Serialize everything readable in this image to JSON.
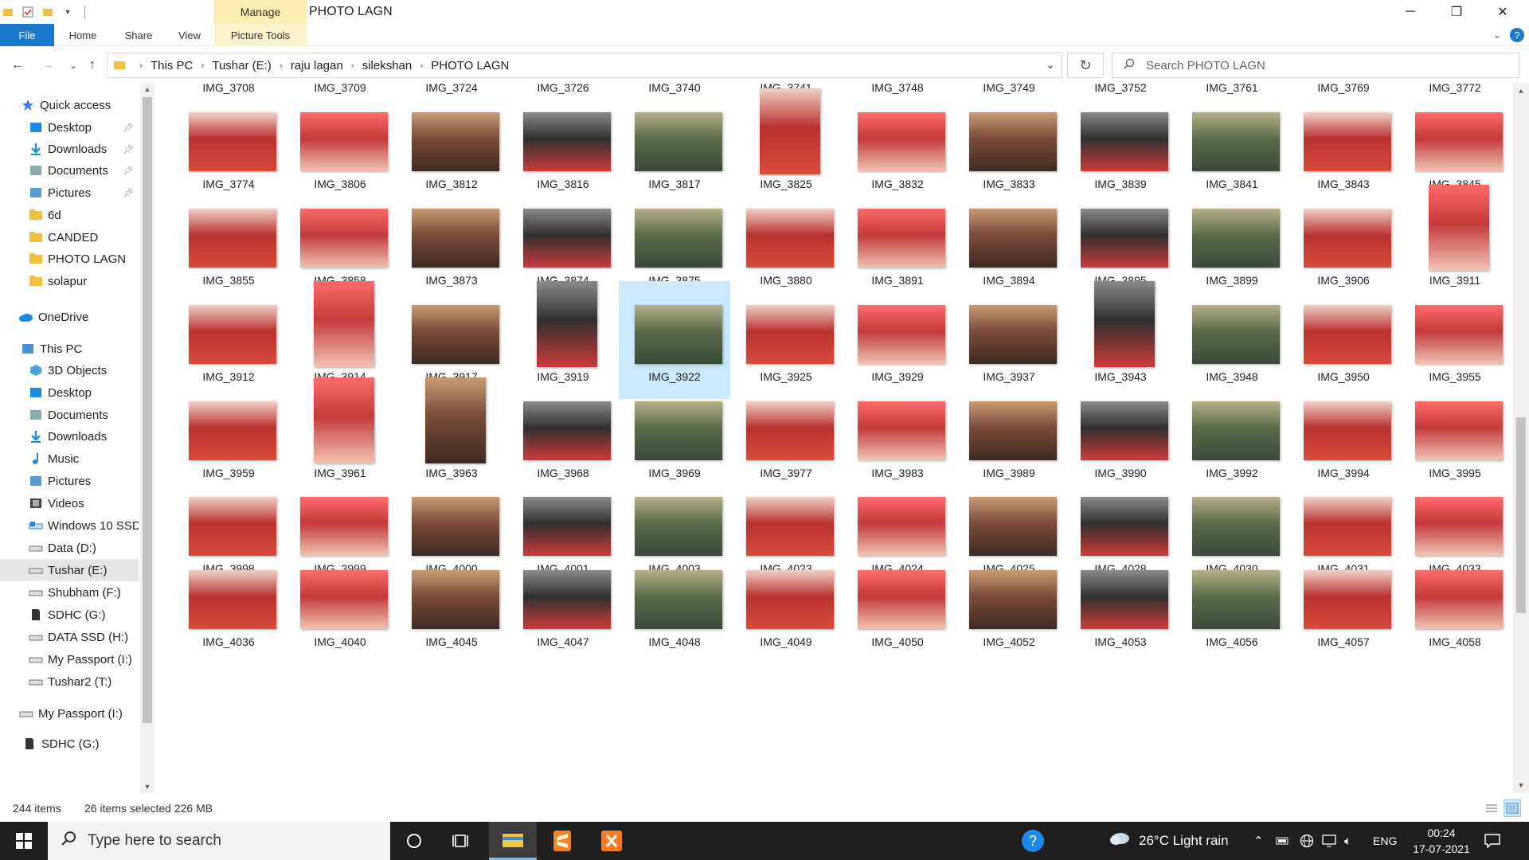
{
  "window": {
    "title": "PHOTO  LAGN",
    "context_tab": "Manage"
  },
  "ribbon": {
    "tabs": [
      "File",
      "Home",
      "Share",
      "View",
      "Picture Tools"
    ]
  },
  "address": {
    "crumbs": [
      "This PC",
      "Tushar (E:)",
      "raju lagan",
      "silekshan",
      "PHOTO  LAGN"
    ],
    "search_placeholder": "Search PHOTO  LAGN"
  },
  "nav": {
    "items": [
      {
        "label": "Quick access",
        "icon": "star-icon",
        "color": "#2b7de9",
        "pinned": false
      },
      {
        "label": "Desktop",
        "icon": "desktop-folder-icon",
        "color": "#1e88e5",
        "pinned": true
      },
      {
        "label": "Downloads",
        "icon": "download-arrow-icon",
        "color": "#1e88e5",
        "pinned": true
      },
      {
        "label": "Documents",
        "icon": "documents-icon",
        "color": "#8aa",
        "pinned": true
      },
      {
        "label": "Pictures",
        "icon": "pictures-icon",
        "color": "#5b9bd5",
        "pinned": true
      },
      {
        "label": "6d",
        "icon": "folder-icon",
        "color": "#f0c040",
        "pinned": false
      },
      {
        "label": "CANDED",
        "icon": "folder-icon",
        "color": "#f0c040",
        "pinned": false
      },
      {
        "label": "PHOTO  LAGN",
        "icon": "folder-icon",
        "color": "#f0c040",
        "pinned": false
      },
      {
        "label": "solapur",
        "icon": "folder-icon",
        "color": "#f0c040",
        "pinned": false
      },
      {
        "label": "OneDrive",
        "icon": "cloud-icon",
        "color": "#1e88e5",
        "pinned": false
      },
      {
        "label": "This PC",
        "icon": "computer-icon",
        "color": "#4a90d9",
        "pinned": false
      },
      {
        "label": "3D Objects",
        "icon": "cube-icon",
        "color": "#4aa3df",
        "pinned": false
      },
      {
        "label": "Desktop",
        "icon": "desktop-folder-icon",
        "color": "#1e88e5",
        "pinned": false
      },
      {
        "label": "Documents",
        "icon": "documents-icon",
        "color": "#8aa",
        "pinned": false
      },
      {
        "label": "Downloads",
        "icon": "download-arrow-icon",
        "color": "#1e88e5",
        "pinned": false
      },
      {
        "label": "Music",
        "icon": "music-note-icon",
        "color": "#1e88e5",
        "pinned": false
      },
      {
        "label": "Pictures",
        "icon": "pictures-icon",
        "color": "#5b9bd5",
        "pinned": false
      },
      {
        "label": "Videos",
        "icon": "film-icon",
        "color": "#555",
        "pinned": false
      },
      {
        "label": "Windows 10 SSD",
        "icon": "windows-drive-icon",
        "color": "#1e88e5",
        "pinned": false
      },
      {
        "label": "Data (D:)",
        "icon": "drive-icon",
        "color": "#777",
        "pinned": false
      },
      {
        "label": "Tushar (E:)",
        "icon": "drive-icon",
        "color": "#777",
        "pinned": false
      },
      {
        "label": "Shubham (F:)",
        "icon": "drive-icon",
        "color": "#777",
        "pinned": false
      },
      {
        "label": "SDHC (G:)",
        "icon": "sd-card-icon",
        "color": "#555",
        "pinned": false
      },
      {
        "label": "DATA SSD (H:)",
        "icon": "drive-icon",
        "color": "#777",
        "pinned": false
      },
      {
        "label": "My Passport (I:)",
        "icon": "drive-icon",
        "color": "#777",
        "pinned": false
      },
      {
        "label": "Tushar2 (T:)",
        "icon": "drive-icon",
        "color": "#777",
        "pinned": false
      },
      {
        "label": "My Passport (I:)",
        "icon": "drive-icon",
        "color": "#777",
        "pinned": false
      },
      {
        "label": "SDHC (G:)",
        "icon": "sd-card-icon",
        "color": "#555",
        "pinned": false
      }
    ],
    "selected": "Tushar (E:)"
  },
  "files": {
    "rows": [
      [
        "IMG_3708",
        "IMG_3709",
        "IMG_3724",
        "IMG_3726",
        "IMG_3740",
        "IMG_3741",
        "IMG_3748",
        "IMG_3749",
        "IMG_3752",
        "IMG_3761",
        "IMG_3769",
        "IMG_3772"
      ],
      [
        "IMG_3774",
        "IMG_3806",
        "IMG_3812",
        "IMG_3816",
        "IMG_3817",
        "IMG_3825",
        "IMG_3832",
        "IMG_3833",
        "IMG_3839",
        "IMG_3841",
        "IMG_3843",
        "IMG_3845"
      ],
      [
        "IMG_3855",
        "IMG_3858",
        "IMG_3873",
        "IMG_3874",
        "IMG_3875",
        "IMG_3880",
        "IMG_3891",
        "IMG_3894",
        "IMG_3895",
        "IMG_3899",
        "IMG_3906",
        "IMG_3911"
      ],
      [
        "IMG_3912",
        "IMG_3914",
        "IMG_3917",
        "IMG_3919",
        "IMG_3922",
        "IMG_3925",
        "IMG_3929",
        "IMG_3937",
        "IMG_3943",
        "IMG_3948",
        "IMG_3950",
        "IMG_3955"
      ],
      [
        "IMG_3959",
        "IMG_3961",
        "IMG_3963",
        "IMG_3968",
        "IMG_3969",
        "IMG_3977",
        "IMG_3983",
        "IMG_3989",
        "IMG_3990",
        "IMG_3992",
        "IMG_3994",
        "IMG_3995"
      ],
      [
        "IMG_3998",
        "IMG_3999",
        "IMG_4000",
        "IMG_4001",
        "IMG_4003",
        "IMG_4023",
        "IMG_4024",
        "IMG_4025",
        "IMG_4028",
        "IMG_4030",
        "IMG_4031",
        "IMG_4033"
      ],
      [
        "IMG_4036",
        "IMG_4040",
        "IMG_4045",
        "IMG_4047",
        "IMG_4048",
        "IMG_4049",
        "IMG_4050",
        "IMG_4052",
        "IMG_4053",
        "IMG_4056",
        "IMG_4057",
        "IMG_4058"
      ]
    ],
    "selected": "IMG_3922",
    "portrait": [
      "IMG_3825",
      "IMG_3911",
      "IMG_3914",
      "IMG_3919",
      "IMG_3943",
      "IMG_3961",
      "IMG_3963"
    ]
  },
  "status": {
    "items": "244 items",
    "selected": "26 items selected  226 MB"
  },
  "taskbar": {
    "search_placeholder": "Type here to search",
    "weather": "26°C  Light rain",
    "lang": "ENG",
    "time": "00:24",
    "date": "17-07-2021"
  },
  "colors": {
    "accent": "#1979ca",
    "selection": "#cce8ff",
    "taskbar": "#1f1f1f"
  }
}
